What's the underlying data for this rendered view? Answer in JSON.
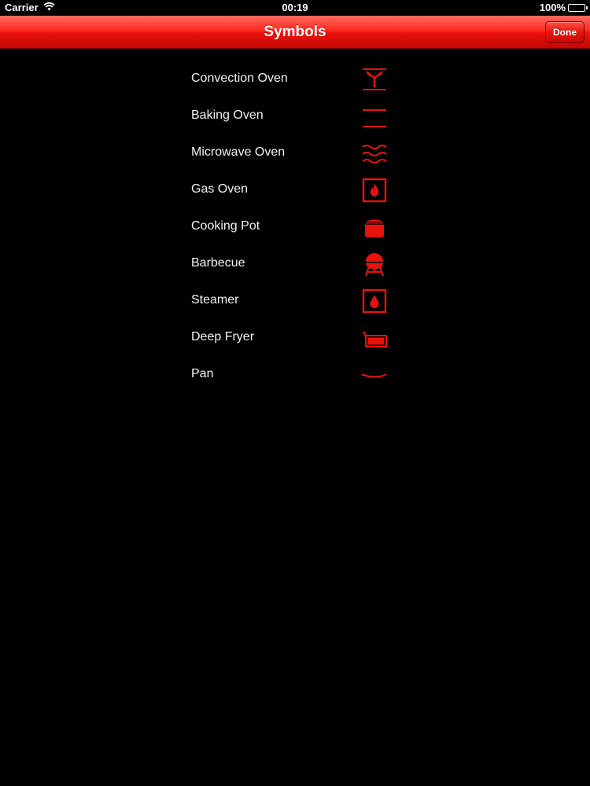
{
  "status_bar": {
    "carrier": "Carrier",
    "time": "00:19",
    "battery": "100%"
  },
  "nav": {
    "title": "Symbols",
    "done_label": "Done"
  },
  "colors": {
    "accent": "#ff1a10",
    "icon": "#e8120c",
    "background": "#000000",
    "text": "#f2f2f2"
  },
  "symbols": [
    {
      "label": "Convection Oven",
      "icon": "convection-oven-icon"
    },
    {
      "label": "Baking Oven",
      "icon": "baking-oven-icon"
    },
    {
      "label": "Microwave Oven",
      "icon": "microwave-oven-icon"
    },
    {
      "label": "Gas Oven",
      "icon": "gas-oven-icon"
    },
    {
      "label": "Cooking Pot",
      "icon": "cooking-pot-icon"
    },
    {
      "label": "Barbecue",
      "icon": "barbecue-icon"
    },
    {
      "label": "Steamer",
      "icon": "steamer-icon"
    },
    {
      "label": "Deep Fryer",
      "icon": "deep-fryer-icon"
    },
    {
      "label": "Pan",
      "icon": "pan-icon"
    }
  ]
}
